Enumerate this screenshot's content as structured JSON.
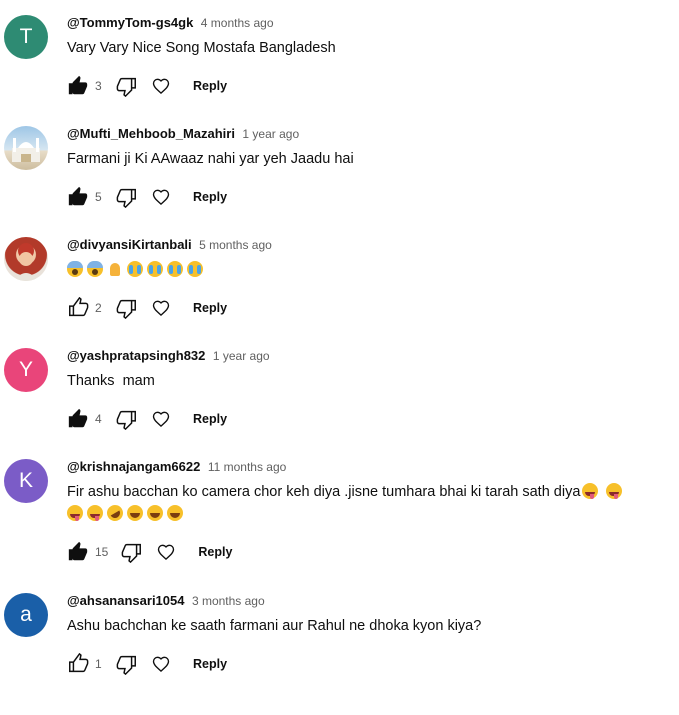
{
  "icons": {
    "like_filled": "thumb-up-filled-icon",
    "like_outline": "thumb-up-outline-icon",
    "dislike": "thumb-down-outline-icon",
    "heart": "heart-outline-icon"
  },
  "reply_label": "Reply",
  "comments": [
    {
      "author": "@TommyTom-gs4gk",
      "time": "4 months ago",
      "avatar_letter": "T",
      "avatar_color": "#2e8b73",
      "text": "Vary Vary Nice Song Mostafa Bangladesh",
      "likes": "3",
      "liked": true
    },
    {
      "author": "@Mufti_Mehboob_Mazahiri",
      "time": "1 year ago",
      "avatar_letter": "",
      "avatar_color": "#c9d9e8",
      "text": "Farmani ji Ki AAwaaz nahi yar yeh Jaadu hai",
      "likes": "5",
      "liked": true
    },
    {
      "author": "@divyansiKirtanbali",
      "time": "5 months ago",
      "avatar_letter": "",
      "avatar_color": "#b23a2a",
      "text": "",
      "emojis": [
        "scream",
        "scream",
        "pray",
        "cry",
        "cry",
        "cry",
        "cry"
      ],
      "likes": "2",
      "liked": false
    },
    {
      "author": "@yashpratapsingh832",
      "time": "1 year ago",
      "avatar_letter": "Y",
      "avatar_color": "#e9457a",
      "text": "Thanks  mam",
      "likes": "4",
      "liked": true
    },
    {
      "author": "@krishnajangam6622",
      "time": "11 months ago",
      "avatar_letter": "K",
      "avatar_color": "#7b5cc7",
      "text": "Fir ashu bacchan ko camera chor keh diya .jisne tumhara bhai ki tarah sath diya",
      "emojis_inline": [
        "wink",
        "wink"
      ],
      "emojis_line2": [
        "wink",
        "wink",
        "rofl",
        "laugh",
        "laugh",
        "laugh"
      ],
      "likes": "15",
      "liked": true
    },
    {
      "author": "@ahsanansari1054",
      "time": "3 months ago",
      "avatar_letter": "a",
      "avatar_color": "#1a5fa8",
      "text": "Ashu bachchan ke saath farmani aur Rahul ne dhoka kyon kiya?",
      "likes": "1",
      "liked": false
    }
  ]
}
